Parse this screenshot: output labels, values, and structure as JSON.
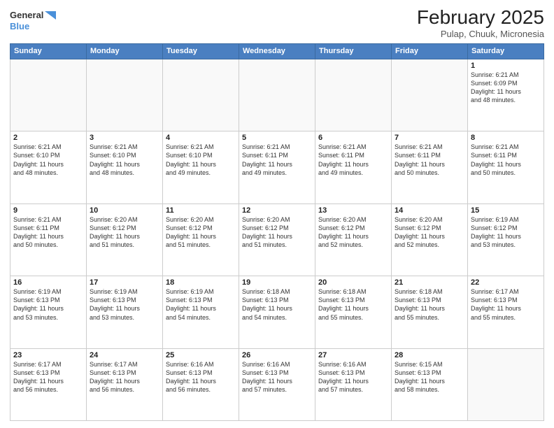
{
  "header": {
    "logo_line1": "General",
    "logo_line2": "Blue",
    "month": "February 2025",
    "location": "Pulap, Chuuk, Micronesia"
  },
  "weekdays": [
    "Sunday",
    "Monday",
    "Tuesday",
    "Wednesday",
    "Thursday",
    "Friday",
    "Saturday"
  ],
  "weeks": [
    [
      {
        "day": "",
        "info": ""
      },
      {
        "day": "",
        "info": ""
      },
      {
        "day": "",
        "info": ""
      },
      {
        "day": "",
        "info": ""
      },
      {
        "day": "",
        "info": ""
      },
      {
        "day": "",
        "info": ""
      },
      {
        "day": "1",
        "info": "Sunrise: 6:21 AM\nSunset: 6:09 PM\nDaylight: 11 hours\nand 48 minutes."
      }
    ],
    [
      {
        "day": "2",
        "info": "Sunrise: 6:21 AM\nSunset: 6:10 PM\nDaylight: 11 hours\nand 48 minutes."
      },
      {
        "day": "3",
        "info": "Sunrise: 6:21 AM\nSunset: 6:10 PM\nDaylight: 11 hours\nand 48 minutes."
      },
      {
        "day": "4",
        "info": "Sunrise: 6:21 AM\nSunset: 6:10 PM\nDaylight: 11 hours\nand 49 minutes."
      },
      {
        "day": "5",
        "info": "Sunrise: 6:21 AM\nSunset: 6:11 PM\nDaylight: 11 hours\nand 49 minutes."
      },
      {
        "day": "6",
        "info": "Sunrise: 6:21 AM\nSunset: 6:11 PM\nDaylight: 11 hours\nand 49 minutes."
      },
      {
        "day": "7",
        "info": "Sunrise: 6:21 AM\nSunset: 6:11 PM\nDaylight: 11 hours\nand 50 minutes."
      },
      {
        "day": "8",
        "info": "Sunrise: 6:21 AM\nSunset: 6:11 PM\nDaylight: 11 hours\nand 50 minutes."
      }
    ],
    [
      {
        "day": "9",
        "info": "Sunrise: 6:21 AM\nSunset: 6:11 PM\nDaylight: 11 hours\nand 50 minutes."
      },
      {
        "day": "10",
        "info": "Sunrise: 6:20 AM\nSunset: 6:12 PM\nDaylight: 11 hours\nand 51 minutes."
      },
      {
        "day": "11",
        "info": "Sunrise: 6:20 AM\nSunset: 6:12 PM\nDaylight: 11 hours\nand 51 minutes."
      },
      {
        "day": "12",
        "info": "Sunrise: 6:20 AM\nSunset: 6:12 PM\nDaylight: 11 hours\nand 51 minutes."
      },
      {
        "day": "13",
        "info": "Sunrise: 6:20 AM\nSunset: 6:12 PM\nDaylight: 11 hours\nand 52 minutes."
      },
      {
        "day": "14",
        "info": "Sunrise: 6:20 AM\nSunset: 6:12 PM\nDaylight: 11 hours\nand 52 minutes."
      },
      {
        "day": "15",
        "info": "Sunrise: 6:19 AM\nSunset: 6:12 PM\nDaylight: 11 hours\nand 53 minutes."
      }
    ],
    [
      {
        "day": "16",
        "info": "Sunrise: 6:19 AM\nSunset: 6:13 PM\nDaylight: 11 hours\nand 53 minutes."
      },
      {
        "day": "17",
        "info": "Sunrise: 6:19 AM\nSunset: 6:13 PM\nDaylight: 11 hours\nand 53 minutes."
      },
      {
        "day": "18",
        "info": "Sunrise: 6:19 AM\nSunset: 6:13 PM\nDaylight: 11 hours\nand 54 minutes."
      },
      {
        "day": "19",
        "info": "Sunrise: 6:18 AM\nSunset: 6:13 PM\nDaylight: 11 hours\nand 54 minutes."
      },
      {
        "day": "20",
        "info": "Sunrise: 6:18 AM\nSunset: 6:13 PM\nDaylight: 11 hours\nand 55 minutes."
      },
      {
        "day": "21",
        "info": "Sunrise: 6:18 AM\nSunset: 6:13 PM\nDaylight: 11 hours\nand 55 minutes."
      },
      {
        "day": "22",
        "info": "Sunrise: 6:17 AM\nSunset: 6:13 PM\nDaylight: 11 hours\nand 55 minutes."
      }
    ],
    [
      {
        "day": "23",
        "info": "Sunrise: 6:17 AM\nSunset: 6:13 PM\nDaylight: 11 hours\nand 56 minutes."
      },
      {
        "day": "24",
        "info": "Sunrise: 6:17 AM\nSunset: 6:13 PM\nDaylight: 11 hours\nand 56 minutes."
      },
      {
        "day": "25",
        "info": "Sunrise: 6:16 AM\nSunset: 6:13 PM\nDaylight: 11 hours\nand 56 minutes."
      },
      {
        "day": "26",
        "info": "Sunrise: 6:16 AM\nSunset: 6:13 PM\nDaylight: 11 hours\nand 57 minutes."
      },
      {
        "day": "27",
        "info": "Sunrise: 6:16 AM\nSunset: 6:13 PM\nDaylight: 11 hours\nand 57 minutes."
      },
      {
        "day": "28",
        "info": "Sunrise: 6:15 AM\nSunset: 6:13 PM\nDaylight: 11 hours\nand 58 minutes."
      },
      {
        "day": "",
        "info": ""
      }
    ]
  ]
}
